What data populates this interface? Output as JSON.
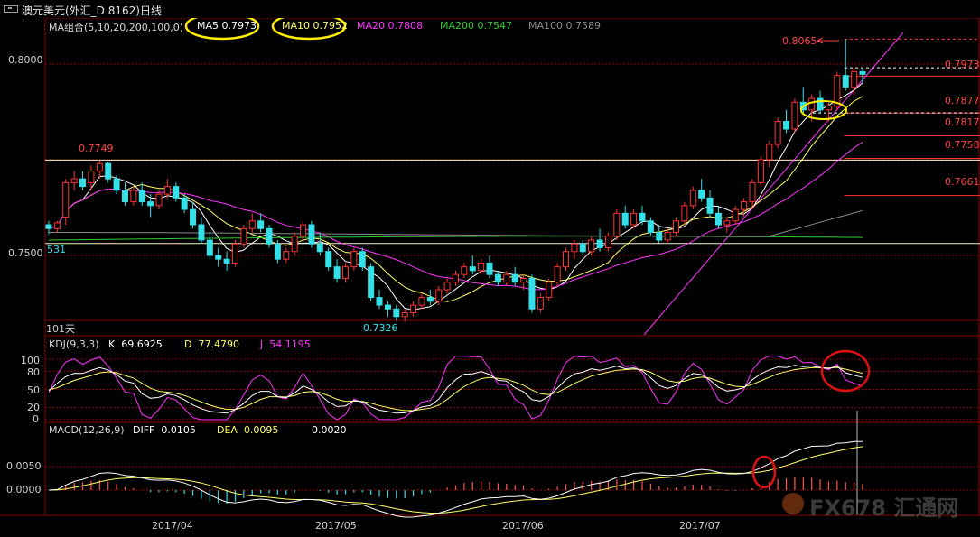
{
  "title": "澳元美元(外汇_D 8162)日线",
  "ma_legend": [
    {
      "label": "MA组合(5,10,20,200,100,0)",
      "color": "#d8d8d8"
    },
    {
      "label": "MA5 0.7973",
      "color": "#ffffff"
    },
    {
      "label": "MA10 0.7952",
      "color": "#ffff66"
    },
    {
      "label": "MA20 0.7808",
      "color": "#ff33ff"
    },
    {
      "label": "MA200 0.7547",
      "color": "#33cc33"
    },
    {
      "label": "MA100 0.7589",
      "color": "#8a8a8a"
    }
  ],
  "kdj_legend": [
    {
      "label": "KDJ(9,3,3)",
      "color": "#d8d8d8"
    },
    {
      "label": "K  69.6925",
      "color": "#ffffff"
    },
    {
      "label": "D  77.4790",
      "color": "#ffff66"
    },
    {
      "label": "J  54.1195",
      "color": "#ff33ff"
    }
  ],
  "macd_legend": [
    {
      "label": "MACD(12,26,9)",
      "color": "#d8d8d8"
    },
    {
      "label": "DIFF  0.0105",
      "color": "#ffffff"
    },
    {
      "label": "DEA  0.0095",
      "color": "#ffff66"
    },
    {
      "label": "0.0020",
      "color": "#ffffff"
    }
  ],
  "labels": {
    "period": "101天",
    "low": "0.7326",
    "high_left": "0.7749",
    "high_right": "0.8065",
    "left_531": "531"
  },
  "price_levels": [
    "0.7973",
    "0.7877",
    "0.7817",
    "0.7758",
    "0.7661"
  ],
  "watermark": "FX678 汇通网",
  "colors": {
    "up": "#ff3333",
    "down": "#33e0e8",
    "grid": "#8b0000",
    "ref_line": "#f3f3c8"
  },
  "chart_data": [
    {
      "type": "candlestick",
      "title": "澳元美元(外汇_D 8162)日线",
      "x_ticks": [
        "2017/04",
        "2017/05",
        "2017/06",
        "2017/07"
      ],
      "y_ticks": [
        "0.8000",
        "0.7500"
      ],
      "ylim": [
        0.729,
        0.808
      ],
      "reference_lines": [
        0.7749,
        0.7531
      ],
      "annotations": {
        "high": 0.8065,
        "low": 0.7326
      },
      "series": [
        {
          "name": "MA5",
          "last": 0.7973
        },
        {
          "name": "MA10",
          "last": 0.7952
        },
        {
          "name": "MA20",
          "last": 0.7808
        },
        {
          "name": "MA200",
          "last": 0.7547
        },
        {
          "name": "MA100",
          "last": 0.7589
        }
      ],
      "candles": [
        [
          0.758,
          0.759,
          0.7555,
          0.757
        ],
        [
          0.757,
          0.759,
          0.756,
          0.7585
        ],
        [
          0.76,
          0.77,
          0.758,
          0.769
        ],
        [
          0.769,
          0.772,
          0.767,
          0.77
        ],
        [
          0.77,
          0.772,
          0.767,
          0.768
        ],
        [
          0.769,
          0.7735,
          0.767,
          0.772
        ],
        [
          0.772,
          0.7749,
          0.77,
          0.774
        ],
        [
          0.774,
          0.7745,
          0.769,
          0.77
        ],
        [
          0.77,
          0.771,
          0.766,
          0.767
        ],
        [
          0.767,
          0.769,
          0.763,
          0.764
        ],
        [
          0.764,
          0.768,
          0.763,
          0.767
        ],
        [
          0.767,
          0.769,
          0.763,
          0.764
        ],
        [
          0.764,
          0.766,
          0.76,
          0.763
        ],
        [
          0.763,
          0.767,
          0.762,
          0.766
        ],
        [
          0.766,
          0.77,
          0.765,
          0.768
        ],
        [
          0.768,
          0.769,
          0.764,
          0.765
        ],
        [
          0.765,
          0.766,
          0.761,
          0.762
        ],
        [
          0.762,
          0.764,
          0.757,
          0.758
        ],
        [
          0.758,
          0.76,
          0.753,
          0.754
        ],
        [
          0.754,
          0.756,
          0.749,
          0.75
        ],
        [
          0.75,
          0.752,
          0.747,
          0.749
        ],
        [
          0.749,
          0.751,
          0.746,
          0.748
        ],
        [
          0.748,
          0.754,
          0.747,
          0.753
        ],
        [
          0.753,
          0.758,
          0.752,
          0.757
        ],
        [
          0.757,
          0.761,
          0.756,
          0.759
        ],
        [
          0.759,
          0.761,
          0.756,
          0.757
        ],
        [
          0.757,
          0.758,
          0.752,
          0.753
        ],
        [
          0.753,
          0.754,
          0.748,
          0.749
        ],
        [
          0.749,
          0.752,
          0.748,
          0.751
        ],
        [
          0.751,
          0.756,
          0.75,
          0.755
        ],
        [
          0.755,
          0.759,
          0.754,
          0.758
        ],
        [
          0.758,
          0.759,
          0.752,
          0.753
        ],
        [
          0.753,
          0.756,
          0.75,
          0.751
        ],
        [
          0.751,
          0.752,
          0.746,
          0.747
        ],
        [
          0.747,
          0.749,
          0.743,
          0.744
        ],
        [
          0.744,
          0.748,
          0.743,
          0.747
        ],
        [
          0.747,
          0.752,
          0.746,
          0.751
        ],
        [
          0.751,
          0.752,
          0.746,
          0.747
        ],
        [
          0.747,
          0.748,
          0.738,
          0.739
        ],
        [
          0.739,
          0.741,
          0.736,
          0.737
        ],
        [
          0.737,
          0.738,
          0.734,
          0.736
        ],
        [
          0.736,
          0.737,
          0.733,
          0.734
        ],
        [
          0.734,
          0.736,
          0.7326,
          0.735
        ],
        [
          0.735,
          0.738,
          0.734,
          0.737
        ],
        [
          0.737,
          0.74,
          0.736,
          0.739
        ],
        [
          0.739,
          0.741,
          0.737,
          0.738
        ],
        [
          0.738,
          0.742,
          0.737,
          0.741
        ],
        [
          0.741,
          0.744,
          0.74,
          0.743
        ],
        [
          0.743,
          0.746,
          0.742,
          0.745
        ],
        [
          0.745,
          0.748,
          0.744,
          0.747
        ],
        [
          0.747,
          0.75,
          0.745,
          0.746
        ],
        [
          0.746,
          0.749,
          0.745,
          0.748
        ],
        [
          0.748,
          0.75,
          0.744,
          0.745
        ],
        [
          0.745,
          0.746,
          0.742,
          0.743
        ],
        [
          0.743,
          0.746,
          0.742,
          0.745
        ],
        [
          0.745,
          0.747,
          0.742,
          0.743
        ],
        [
          0.743,
          0.745,
          0.741,
          0.744
        ],
        [
          0.744,
          0.745,
          0.735,
          0.736
        ],
        [
          0.736,
          0.74,
          0.735,
          0.739
        ],
        [
          0.739,
          0.744,
          0.738,
          0.743
        ],
        [
          0.743,
          0.748,
          0.742,
          0.747
        ],
        [
          0.747,
          0.752,
          0.746,
          0.751
        ],
        [
          0.751,
          0.754,
          0.749,
          0.753
        ],
        [
          0.753,
          0.754,
          0.75,
          0.751
        ],
        [
          0.751,
          0.755,
          0.75,
          0.754
        ],
        [
          0.754,
          0.757,
          0.751,
          0.752
        ],
        [
          0.752,
          0.756,
          0.751,
          0.755
        ],
        [
          0.755,
          0.762,
          0.754,
          0.761
        ],
        [
          0.761,
          0.763,
          0.757,
          0.758
        ],
        [
          0.758,
          0.762,
          0.757,
          0.761
        ],
        [
          0.761,
          0.763,
          0.758,
          0.759
        ],
        [
          0.759,
          0.76,
          0.755,
          0.756
        ],
        [
          0.756,
          0.758,
          0.753,
          0.754
        ],
        [
          0.754,
          0.757,
          0.753,
          0.756
        ],
        [
          0.756,
          0.76,
          0.755,
          0.759
        ],
        [
          0.759,
          0.764,
          0.758,
          0.763
        ],
        [
          0.763,
          0.768,
          0.762,
          0.767
        ],
        [
          0.767,
          0.77,
          0.764,
          0.765
        ],
        [
          0.765,
          0.767,
          0.76,
          0.761
        ],
        [
          0.761,
          0.763,
          0.757,
          0.758
        ],
        [
          0.758,
          0.76,
          0.756,
          0.759
        ],
        [
          0.759,
          0.763,
          0.758,
          0.762
        ],
        [
          0.762,
          0.765,
          0.76,
          0.764
        ],
        [
          0.764,
          0.77,
          0.762,
          0.769
        ],
        [
          0.769,
          0.776,
          0.768,
          0.775
        ],
        [
          0.775,
          0.78,
          0.773,
          0.779
        ],
        [
          0.779,
          0.786,
          0.778,
          0.785
        ],
        [
          0.785,
          0.788,
          0.782,
          0.783
        ],
        [
          0.783,
          0.791,
          0.782,
          0.79
        ],
        [
          0.79,
          0.794,
          0.787,
          0.788
        ],
        [
          0.788,
          0.792,
          0.785,
          0.791
        ],
        [
          0.791,
          0.793,
          0.787,
          0.788
        ],
        [
          0.788,
          0.79,
          0.785,
          0.789
        ],
        [
          0.789,
          0.798,
          0.788,
          0.797
        ],
        [
          0.797,
          0.8065,
          0.793,
          0.794
        ],
        [
          0.794,
          0.799,
          0.792,
          0.798
        ],
        [
          0.798,
          0.799,
          0.795,
          0.7973
        ]
      ]
    },
    {
      "type": "line",
      "title": "KDJ(9,3,3)",
      "y_ticks": [
        "100",
        "80",
        "50",
        "20",
        "0"
      ],
      "ylim": [
        0,
        110
      ],
      "series": [
        {
          "name": "K",
          "last": 69.6925
        },
        {
          "name": "D",
          "last": 77.479
        },
        {
          "name": "J",
          "last": 54.1195
        }
      ]
    },
    {
      "type": "bar",
      "title": "MACD(12,26,9)",
      "y_ticks": [
        "0.0050",
        "0.0000"
      ],
      "series": [
        {
          "name": "DIFF",
          "last": 0.0105
        },
        {
          "name": "DEA",
          "last": 0.0095
        },
        {
          "name": "MACD",
          "last": 0.002
        }
      ]
    }
  ]
}
